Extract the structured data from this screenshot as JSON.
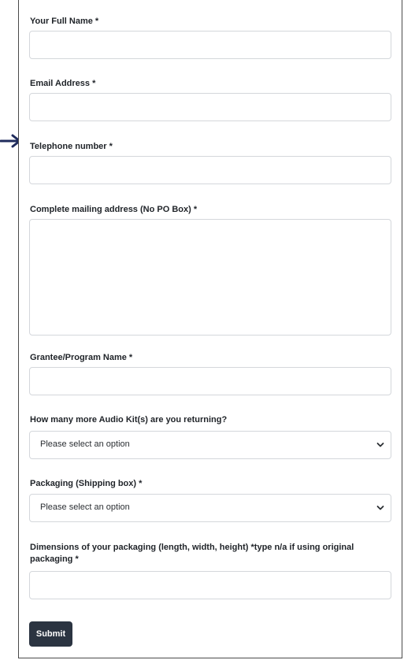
{
  "form": {
    "full_name": {
      "label": "Your Full Name *",
      "value": ""
    },
    "email": {
      "label": "Email Address *",
      "value": ""
    },
    "telephone": {
      "label": "Telephone number *",
      "value": ""
    },
    "mailing_address": {
      "label": "Complete mailing address (No PO Box) *",
      "value": ""
    },
    "grantee": {
      "label": "Grantee/Program Name *",
      "value": ""
    },
    "audio_kits": {
      "label": "How many more Audio Kit(s) are you returning?",
      "selected": "Please select an option"
    },
    "packaging": {
      "label": "Packaging (Shipping box) *",
      "selected": "Please select an option"
    },
    "dimensions": {
      "label": "Dimensions of your packaging (length, width, height) *type n/a if using original packaging *",
      "value": ""
    },
    "submit_label": "Submit"
  },
  "annotation": {
    "arrow_icon": "arrow-right-icon",
    "arrow_color": "#1f2b5c"
  },
  "colors": {
    "button_bg": "#2b3441",
    "border": "#d4d7db"
  }
}
